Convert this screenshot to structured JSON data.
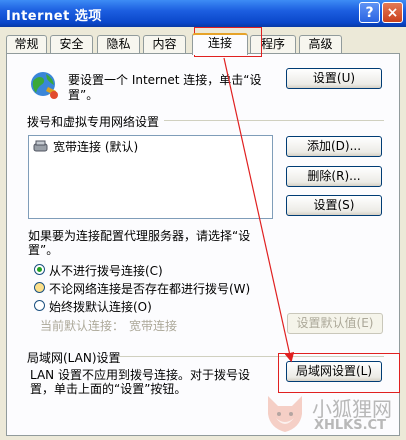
{
  "window": {
    "title": "Internet 选项",
    "help": "?",
    "close": "×"
  },
  "tabs": [
    {
      "label": "常规"
    },
    {
      "label": "安全"
    },
    {
      "label": "隐私"
    },
    {
      "label": "内容"
    },
    {
      "label": "连接"
    },
    {
      "label": "程序"
    },
    {
      "label": "高级"
    }
  ],
  "setup": {
    "text_line1": "要设置一个 Internet 连接，单击“设",
    "text_line2": "置”。",
    "button": "设置(U)"
  },
  "dialup": {
    "heading": "拨号和虚拟专用网络设置",
    "list_item": "宽带连接 (默认)",
    "add_button": "添加(D)...",
    "remove_button": "删除(R)...",
    "settings_button": "设置(S)",
    "proxy_text_line1": "如果要为连接配置代理服务器，请选择“设",
    "proxy_text_line2": "置”。"
  },
  "dial_options": [
    {
      "label": "从不进行拨号连接(C)",
      "checked": true
    },
    {
      "label": "不论网络连接是否存在都进行拨号(W)",
      "checked": false
    },
    {
      "label": "始终拨默认连接(O)",
      "checked": false
    }
  ],
  "default_connection": {
    "label": "当前默认连接：",
    "value": "宽带连接",
    "button": "设置默认值(E)"
  },
  "lan": {
    "heading": "局域网(LAN)设置",
    "text_line1": "LAN 设置不应用到拨号连接。对于拨号设",
    "text_line2": "置，单击上面的“设置”按钮。",
    "button": "局域网设置(L)"
  },
  "watermark": {
    "cn": "小狐狸网",
    "en": "XHLKS.CT"
  },
  "colors": {
    "annotation": "#e02020",
    "titlebar": "#0a46c9"
  }
}
